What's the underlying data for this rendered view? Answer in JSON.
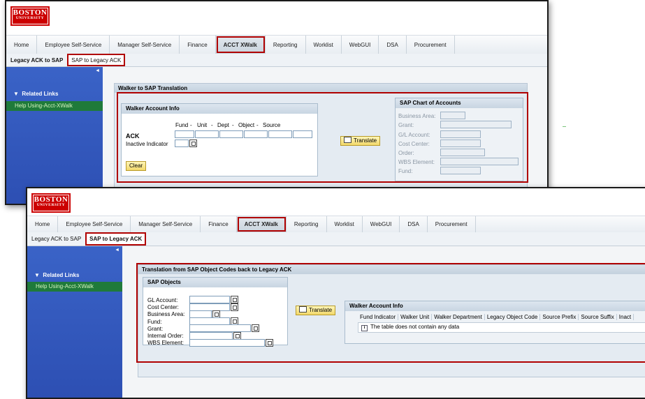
{
  "logo": {
    "line1": "BOSTON",
    "line2": "UNIVERSITY"
  },
  "nav_tabs": [
    "Home",
    "Employee Self-Service",
    "Manager Self-Service",
    "Finance",
    "ACCT XWalk",
    "Reporting",
    "Worklist",
    "WebGUI",
    "DSA",
    "Procurement"
  ],
  "sub_tabs": [
    "Legacy ACK to SAP",
    "SAP to Legacy ACK"
  ],
  "sidebar": {
    "collapse_glyph": "◄",
    "related_links_header": "Related Links",
    "related_link": "Help Using-Acct-XWalk"
  },
  "window1": {
    "panel_title": "Walker to SAP Translation",
    "walker_box_title": "Walker Account Info",
    "segment_labels": [
      "Fund",
      "Unit",
      "Dept",
      "Object",
      "Source"
    ],
    "separator": "-",
    "ack_label": "ACK",
    "inactive_label": "Inactive Indicator",
    "clear_button": "Clear",
    "translate_button": "Translate",
    "sap_box_title": "SAP Chart of Accounts",
    "sap_fields": [
      "Business Area:",
      "Grant:",
      "G/L Account:",
      "Cost Center:",
      "Order:",
      "WBS Element:",
      "Fund:"
    ]
  },
  "window2": {
    "panel_title": "Translation from SAP Object Codes back to Legacy ACK",
    "sap_objects_title": "SAP Objects",
    "sap_object_fields": [
      "GL Account:",
      "Cost Center:",
      "Business Area:",
      "Fund:",
      "Grant:",
      "Internal Order:",
      "WBS Element:"
    ],
    "translate_button": "Translate",
    "walker_box_title": "Walker Account Info",
    "table_headers": [
      "Fund Indicator",
      "Walker Unit",
      "Walker Department",
      "Legacy Object Code",
      "Source Prefix",
      "Source Suffix",
      "Inact"
    ],
    "empty_message": "The table does not contain any data",
    "info_glyph": "i"
  },
  "colors": {
    "brand_red": "#cc0000",
    "highlight_red": "#b00000",
    "sidebar_blue": "#2d4fb3",
    "button_yellow": "#f2d86a"
  }
}
